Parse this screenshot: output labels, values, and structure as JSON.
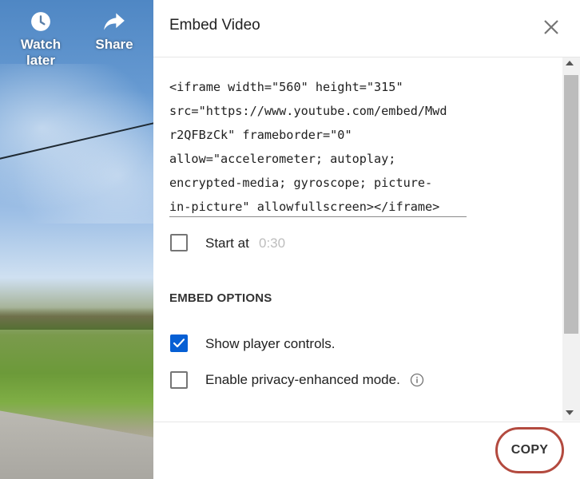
{
  "video": {
    "watch_later_label": "Watch later",
    "share_label": "Share"
  },
  "dialog": {
    "title": "Embed Video",
    "embed_code": "<iframe width=\"560\" height=\"315\"\nsrc=\"https://www.youtube.com/embed/Mwd\nr2QFBzCk\" frameborder=\"0\"\nallow=\"accelerometer; autoplay;\nencrypted-media; gyroscope; picture-\nin-picture\" allowfullscreen></iframe>",
    "start_at": {
      "label": "Start at",
      "time": "0:30",
      "checked": false
    },
    "embed_options": {
      "heading": "EMBED OPTIONS",
      "show_player_controls": {
        "label": "Show player controls.",
        "checked": true
      },
      "privacy_enhanced": {
        "label": "Enable privacy-enhanced mode.",
        "checked": false
      }
    },
    "copy_label": "COPY"
  },
  "colors": {
    "accent": "#065fd4",
    "highlight_ring": "#b34a3f"
  }
}
